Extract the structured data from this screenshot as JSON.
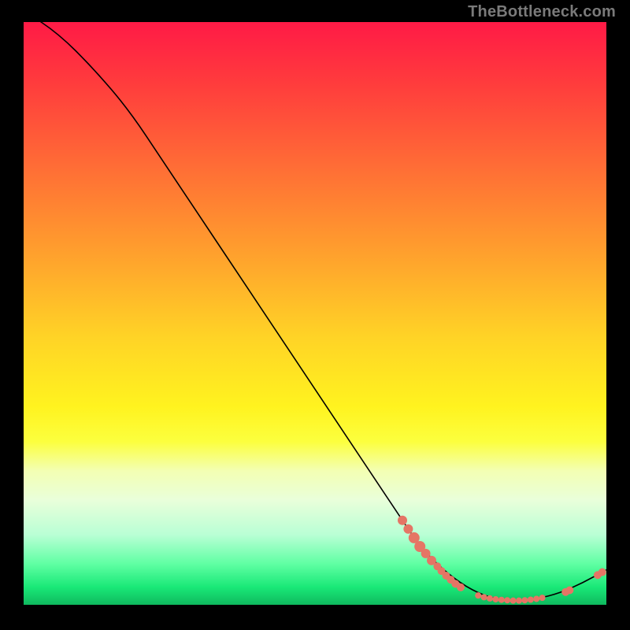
{
  "watermark": "TheBottleneck.com",
  "colors": {
    "dot": "#e57565",
    "curve": "#000000",
    "background": "#000000"
  },
  "chart_data": {
    "type": "line",
    "title": "",
    "xlabel": "",
    "ylabel": "",
    "xlim": [
      0,
      100
    ],
    "ylim": [
      0,
      100
    ],
    "grid": false,
    "curve_points": [
      {
        "x": 0,
        "y": 102
      },
      {
        "x": 6,
        "y": 98
      },
      {
        "x": 12,
        "y": 92
      },
      {
        "x": 18,
        "y": 85
      },
      {
        "x": 24,
        "y": 76
      },
      {
        "x": 30,
        "y": 67
      },
      {
        "x": 36,
        "y": 58
      },
      {
        "x": 42,
        "y": 49
      },
      {
        "x": 48,
        "y": 40
      },
      {
        "x": 54,
        "y": 31
      },
      {
        "x": 60,
        "y": 22
      },
      {
        "x": 64,
        "y": 16
      },
      {
        "x": 68,
        "y": 10
      },
      {
        "x": 72,
        "y": 6
      },
      {
        "x": 76,
        "y": 3
      },
      {
        "x": 80,
        "y": 1.2
      },
      {
        "x": 84,
        "y": 0.7
      },
      {
        "x": 88,
        "y": 1.0
      },
      {
        "x": 92,
        "y": 2.0
      },
      {
        "x": 96,
        "y": 3.8
      },
      {
        "x": 100,
        "y": 6.0
      }
    ],
    "dots": [
      {
        "x": 65,
        "y": 14.5,
        "r": 6
      },
      {
        "x": 66,
        "y": 13.0,
        "r": 6
      },
      {
        "x": 67,
        "y": 11.5,
        "r": 7
      },
      {
        "x": 68,
        "y": 10.0,
        "r": 7
      },
      {
        "x": 69,
        "y": 8.8,
        "r": 6
      },
      {
        "x": 70,
        "y": 7.6,
        "r": 6
      },
      {
        "x": 71,
        "y": 6.6,
        "r": 5
      },
      {
        "x": 71.7,
        "y": 5.8,
        "r": 5
      },
      {
        "x": 72.5,
        "y": 5.0,
        "r": 5
      },
      {
        "x": 73.3,
        "y": 4.3,
        "r": 5
      },
      {
        "x": 74.1,
        "y": 3.6,
        "r": 5
      },
      {
        "x": 75.0,
        "y": 3.0,
        "r": 5
      },
      {
        "x": 78.0,
        "y": 1.6,
        "r": 4
      },
      {
        "x": 79.0,
        "y": 1.3,
        "r": 4
      },
      {
        "x": 80.0,
        "y": 1.1,
        "r": 4
      },
      {
        "x": 81.0,
        "y": 0.95,
        "r": 4
      },
      {
        "x": 82.0,
        "y": 0.85,
        "r": 4
      },
      {
        "x": 83.0,
        "y": 0.78,
        "r": 4
      },
      {
        "x": 84.0,
        "y": 0.72,
        "r": 4
      },
      {
        "x": 85.0,
        "y": 0.72,
        "r": 4
      },
      {
        "x": 86.0,
        "y": 0.78,
        "r": 4
      },
      {
        "x": 87.0,
        "y": 0.88,
        "r": 4
      },
      {
        "x": 88.0,
        "y": 1.02,
        "r": 4
      },
      {
        "x": 89.0,
        "y": 1.2,
        "r": 4
      },
      {
        "x": 93.0,
        "y": 2.2,
        "r": 5
      },
      {
        "x": 93.7,
        "y": 2.5,
        "r": 5
      },
      {
        "x": 98.5,
        "y": 5.1,
        "r": 5
      },
      {
        "x": 99.3,
        "y": 5.6,
        "r": 5
      }
    ]
  }
}
